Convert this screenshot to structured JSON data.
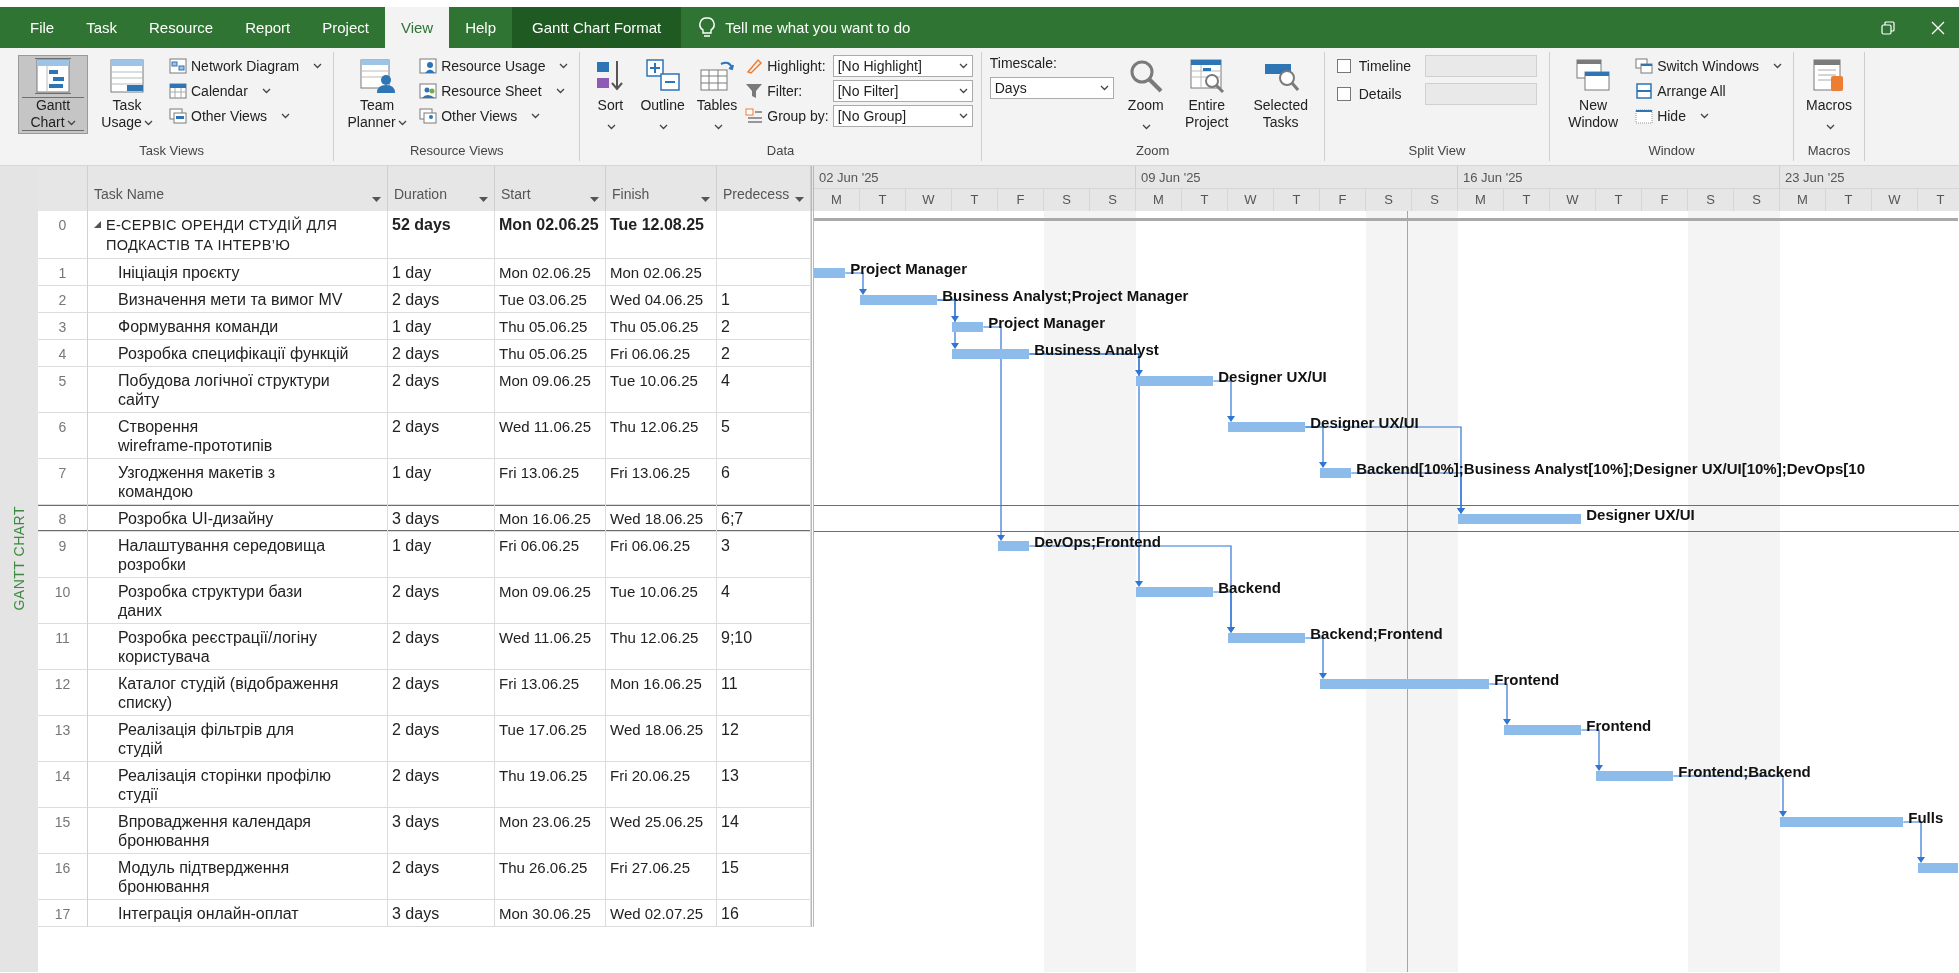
{
  "window": {
    "tabs": [
      {
        "label": "File",
        "selected": false,
        "kind": "tab"
      },
      {
        "label": "Task",
        "selected": false,
        "kind": "tab"
      },
      {
        "label": "Resource",
        "selected": false,
        "kind": "tab"
      },
      {
        "label": "Report",
        "selected": false,
        "kind": "tab"
      },
      {
        "label": "Project",
        "selected": false,
        "kind": "tab"
      },
      {
        "label": "View",
        "selected": true,
        "kind": "tab"
      },
      {
        "label": "Help",
        "selected": false,
        "kind": "tab"
      },
      {
        "label": "Gantt Chart Format",
        "selected": false,
        "kind": "context"
      }
    ],
    "tell_me": {
      "placeholder": "Tell me what you want to do"
    }
  },
  "ribbon": {
    "groups": [
      {
        "label": "Task Views",
        "items": [
          {
            "kind": "large",
            "label": "Gantt Chart",
            "menu": true,
            "selected": true
          },
          {
            "kind": "large",
            "label": "Task Usage",
            "menu": true,
            "selected": false
          },
          {
            "kind": "stack",
            "items": [
              {
                "label": "Network Diagram",
                "menu": true
              },
              {
                "label": "Calendar",
                "menu": true
              },
              {
                "label": "Other Views",
                "menu": true
              }
            ]
          }
        ]
      },
      {
        "label": "Resource Views",
        "items": [
          {
            "kind": "large",
            "label": "Team Planner",
            "menu": true,
            "selected": false
          },
          {
            "kind": "stack",
            "items": [
              {
                "label": "Resource Usage",
                "menu": true
              },
              {
                "label": "Resource Sheet",
                "menu": true
              },
              {
                "label": "Other Views",
                "menu": true
              }
            ]
          }
        ]
      },
      {
        "label": "Data",
        "items": [
          {
            "kind": "large",
            "label": "Sort",
            "menu": true,
            "selected": false
          },
          {
            "kind": "large",
            "label": "Outline",
            "menu": true,
            "selected": false
          },
          {
            "kind": "large",
            "label": "Tables",
            "menu": true,
            "selected": false
          },
          {
            "kind": "combos",
            "items": [
              {
                "label": "Highlight:",
                "value": "[No Highlight]"
              },
              {
                "label": "Filter:",
                "value": "[No Filter]"
              },
              {
                "label": "Group by:",
                "value": "[No Group]"
              }
            ]
          }
        ]
      },
      {
        "label": "Zoom",
        "items": [
          {
            "kind": "timescale",
            "label": "Timescale:",
            "value": "Days"
          },
          {
            "kind": "large",
            "label": "Zoom",
            "menu": true,
            "selected": false
          },
          {
            "kind": "large",
            "label": "Entire Project",
            "menu": false,
            "selected": false
          },
          {
            "kind": "large",
            "label": "Selected Tasks",
            "menu": false,
            "selected": false
          }
        ]
      },
      {
        "label": "Split View",
        "items": [
          {
            "kind": "checks",
            "items": [
              {
                "label": "Timeline",
                "checked": false
              },
              {
                "label": "Details",
                "checked": false
              }
            ]
          }
        ]
      },
      {
        "label": "Window",
        "items": [
          {
            "kind": "large",
            "label": "New Window",
            "menu": false,
            "selected": false
          },
          {
            "kind": "stack",
            "items": [
              {
                "label": "Switch Windows",
                "menu": true
              },
              {
                "label": "Arrange All",
                "menu": false
              },
              {
                "label": "Hide",
                "menu": true
              }
            ]
          }
        ]
      },
      {
        "label": "Macros",
        "items": [
          {
            "kind": "large",
            "label": "Macros",
            "menu": true,
            "selected": false
          }
        ]
      }
    ]
  },
  "view_bar": {
    "label": "GANTT CHART"
  },
  "table": {
    "columns": [
      "Task Name",
      "Duration",
      "Start",
      "Finish",
      "Predecess"
    ],
    "tasks": [
      {
        "id": "0",
        "name": "Е-СЕРВІС ОРЕНДИ СТУДІЙ ДЛЯ\nПОДКАСТІВ ТА ІНТЕРВ’Ю",
        "duration": "52 days",
        "start": "Mon 02.06.25",
        "finish": "Tue 12.08.25",
        "expanded": true,
        "selected": false,
        "children": [
          {
            "id": "1",
            "name": "Ініціація проєкту",
            "duration": "1 day",
            "start": "Mon 02.06.25",
            "finish": "Mon 02.06.25",
            "selected": false,
            "resources": "Project Manager"
          },
          {
            "id": "2",
            "name": "Визначення мети та вимог MV",
            "duration": "2 days",
            "start": "Tue 03.06.25",
            "finish": "Wed 04.06.25",
            "predecessors": "1",
            "selected": false,
            "resources": "Business Analyst;Project Manager"
          },
          {
            "id": "3",
            "name": "Формування команди",
            "duration": "1 day",
            "start": "Thu 05.06.25",
            "finish": "Thu 05.06.25",
            "predecessors": "2",
            "selected": false,
            "resources": "Project Manager"
          },
          {
            "id": "4",
            "name": "Розробка специфікації функцій",
            "duration": "2 days",
            "start": "Thu 05.06.25",
            "finish": "Fri 06.06.25",
            "predecessors": "2",
            "selected": false,
            "resources": "Business Analyst"
          },
          {
            "id": "5",
            "name": "Побудова логічної структури\nсайту",
            "duration": "2 days",
            "start": "Mon 09.06.25",
            "finish": "Tue 10.06.25",
            "predecessors": "4",
            "selected": false,
            "resources": "Designer UX/UI"
          },
          {
            "id": "6",
            "name": "Створення\nwireframe-прототипів",
            "duration": "2 days",
            "start": "Wed 11.06.25",
            "finish": "Thu 12.06.25",
            "predecessors": "5",
            "selected": false,
            "resources": "Designer UX/UI"
          },
          {
            "id": "7",
            "name": "Узгодження макетів з\nкомандою",
            "duration": "1 day",
            "start": "Fri 13.06.25",
            "finish": "Fri 13.06.25",
            "predecessors": "6",
            "selected": false,
            "resources": "Backend[10%];Business Analyst[10%];Designer UX/UI[10%];DevOps[10"
          },
          {
            "id": "8",
            "name": "Розробка UI-дизайну",
            "duration": "3 days",
            "start": "Mon 16.06.25",
            "finish": "Wed 18.06.25",
            "predecessors": "6;7",
            "selected": true,
            "resources": "Designer UX/UI"
          },
          {
            "id": "9",
            "name": "Налаштування середовища\nрозробки",
            "duration": "1 day",
            "start": "Fri 06.06.25",
            "finish": "Fri 06.06.25",
            "predecessors": "3",
            "selected": false,
            "resources": "DevOps;Frontend"
          },
          {
            "id": "10",
            "name": "Розробка структури бази\nданих",
            "duration": "2 days",
            "start": "Mon 09.06.25",
            "finish": "Tue 10.06.25",
            "predecessors": "4",
            "selected": false,
            "resources": "Backend"
          },
          {
            "id": "11",
            "name": "Розробка реєстрації/логіну\nкористувача",
            "duration": "2 days",
            "start": "Wed 11.06.25",
            "finish": "Thu 12.06.25",
            "predecessors": "9;10",
            "selected": false,
            "resources": "Backend;Frontend"
          },
          {
            "id": "12",
            "name": "Каталог студій (відображення\nсписку)",
            "duration": "2 days",
            "start": "Fri 13.06.25",
            "finish": "Mon 16.06.25",
            "predecessors": "11",
            "selected": false,
            "resources": "Frontend"
          },
          {
            "id": "13",
            "name": "Реалізація фільтрів для\nстудій",
            "duration": "2 days",
            "start": "Tue 17.06.25",
            "finish": "Wed 18.06.25",
            "predecessors": "12",
            "selected": false,
            "resources": "Frontend"
          },
          {
            "id": "14",
            "name": "Реалізація сторінки профілю\nстудії",
            "duration": "2 days",
            "start": "Thu 19.06.25",
            "finish": "Fri 20.06.25",
            "predecessors": "13",
            "selected": false,
            "resources": "Frontend;Backend"
          },
          {
            "id": "15",
            "name": "Впровадження календаря\nбронювання",
            "duration": "3 days",
            "start": "Mon 23.06.25",
            "finish": "Wed 25.06.25",
            "predecessors": "14",
            "selected": false,
            "resources": "Fulls"
          },
          {
            "id": "16",
            "name": "Модуль підтвердження\nбронювання",
            "duration": "2 days",
            "start": "Thu 26.06.25",
            "finish": "Fri 27.06.25",
            "predecessors": "15",
            "selected": false
          },
          {
            "id": "17",
            "name": "Інтеграція онлайн-оплат",
            "duration": "3 days",
            "start": "Mon 30.06.25",
            "finish": "Wed 02.07.25",
            "predecessors": "16",
            "selected": false
          }
        ]
      }
    ]
  },
  "timescale": {
    "weeks": [
      {
        "label": "02 Jun '25",
        "days": [
          "M",
          "T",
          "W",
          "T",
          "F",
          "S",
          "S"
        ]
      },
      {
        "label": "09 Jun '25",
        "days": [
          "M",
          "T",
          "W",
          "T",
          "F",
          "S",
          "S"
        ]
      },
      {
        "label": "16 Jun '25",
        "days": [
          "M",
          "T",
          "W",
          "T",
          "F",
          "S",
          "S"
        ]
      },
      {
        "label": "23 Jun '25",
        "days": [
          "M",
          "T",
          "W",
          "T"
        ]
      }
    ]
  }
}
